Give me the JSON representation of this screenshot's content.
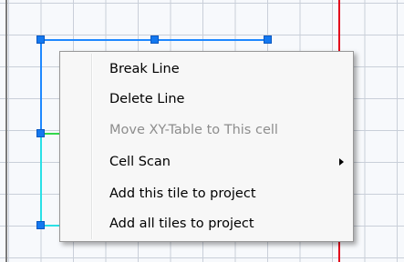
{
  "context_menu": {
    "items": [
      {
        "label": "Break Line",
        "enabled": true,
        "has_submenu": false
      },
      {
        "label": "Delete Line",
        "enabled": true,
        "has_submenu": false
      },
      {
        "label": "Move XY-Table to This cell",
        "enabled": false,
        "has_submenu": false
      },
      {
        "label": "Cell Scan",
        "enabled": true,
        "has_submenu": true
      },
      {
        "label": "Add this tile to project",
        "enabled": true,
        "has_submenu": false
      },
      {
        "label": "Add all tiles to project",
        "enabled": true,
        "has_submenu": false
      }
    ]
  },
  "colors": {
    "selection_line": "#1e88ff",
    "boundary_line": "#e2001a",
    "grid_line": "#c9cfd9",
    "handle": "#1478f0"
  }
}
